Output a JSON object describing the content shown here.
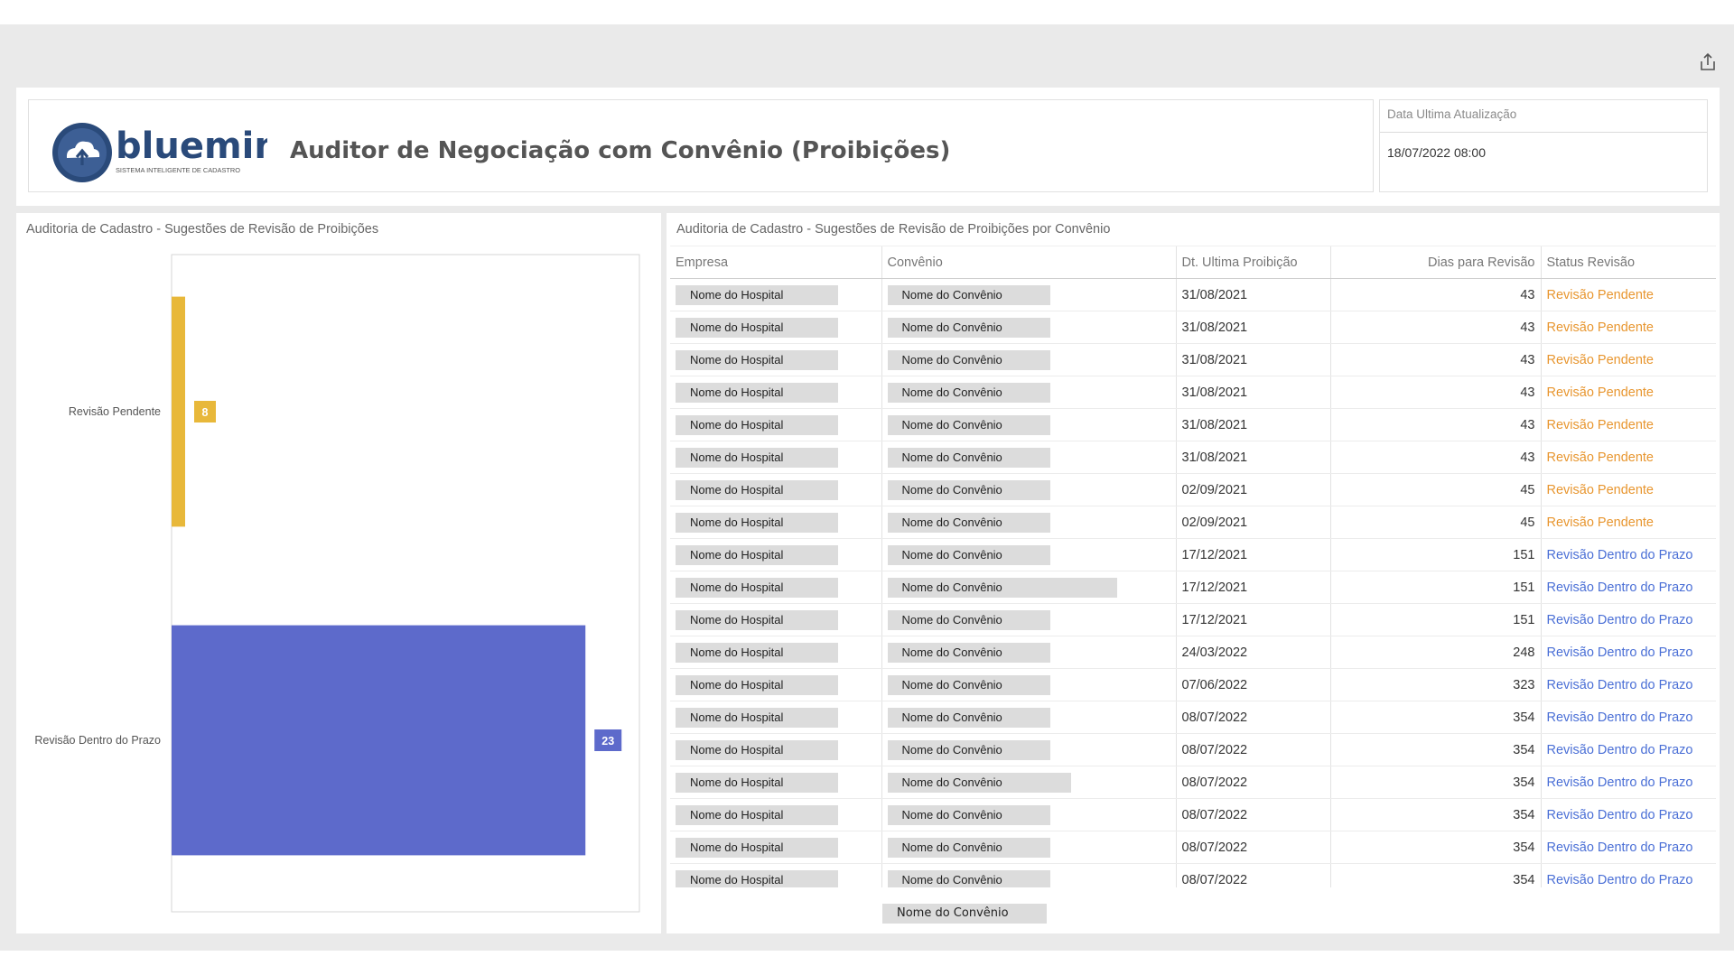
{
  "header": {
    "logo_text": "bluemind",
    "logo_tagline": "SISTEMA INTELIGENTE DE CADASTRO",
    "title": "Auditor de Negociação com Convênio (Proibições)",
    "update_label": "Data Ultima Atualização",
    "update_value": "18/07/2022 08:00"
  },
  "chart_panel": {
    "title": "Auditoria de Cadastro - Sugestões de Revisão de Proibições"
  },
  "chart_data": {
    "type": "bar",
    "orientation": "horizontal",
    "categories": [
      "Revisão Pendente",
      "Revisão Dentro do Prazo"
    ],
    "values": [
      8,
      23
    ],
    "colors": [
      "#e8b83a",
      "#5d6acb"
    ],
    "xlim": [
      0,
      26
    ],
    "grid": false
  },
  "table_panel": {
    "title": "Auditoria de Cadastro - Sugestões de Revisão de Proibições por Convênio",
    "columns": [
      "Empresa",
      "Convênio",
      "Dt. Ultima Proibição",
      "Dias para Revisão",
      "Status Revisão"
    ],
    "rows": [
      {
        "empresa": "Nome do Hospital",
        "convenio": "Nome do Convênio",
        "data": "31/08/2021",
        "dias": "43",
        "status": "Revisão Pendente",
        "kind": "pending"
      },
      {
        "empresa": "Nome do Hospital",
        "convenio": "Nome do Convênio",
        "data": "31/08/2021",
        "dias": "43",
        "status": "Revisão Pendente",
        "kind": "pending"
      },
      {
        "empresa": "Nome do Hospital",
        "convenio": "Nome do Convênio",
        "data": "31/08/2021",
        "dias": "43",
        "status": "Revisão Pendente",
        "kind": "pending"
      },
      {
        "empresa": "Nome do Hospital",
        "convenio": "Nome do Convênio",
        "data": "31/08/2021",
        "dias": "43",
        "status": "Revisão Pendente",
        "kind": "pending"
      },
      {
        "empresa": "Nome do Hospital",
        "convenio": "Nome do Convênio",
        "data": "31/08/2021",
        "dias": "43",
        "status": "Revisão Pendente",
        "kind": "pending"
      },
      {
        "empresa": "Nome do Hospital",
        "convenio": "Nome do Convênio",
        "data": "31/08/2021",
        "dias": "43",
        "status": "Revisão Pendente",
        "kind": "pending"
      },
      {
        "empresa": "Nome do Hospital",
        "convenio": "Nome do Convênio",
        "data": "02/09/2021",
        "dias": "45",
        "status": "Revisão Pendente",
        "kind": "pending"
      },
      {
        "empresa": "Nome do Hospital",
        "convenio": "Nome do Convênio",
        "data": "02/09/2021",
        "dias": "45",
        "status": "Revisão Pendente",
        "kind": "pending"
      },
      {
        "empresa": "Nome do Hospital",
        "convenio": "Nome do Convênio",
        "data": "17/12/2021",
        "dias": "151",
        "status": "Revisão Dentro do Prazo",
        "kind": "ok"
      },
      {
        "empresa": "Nome do Hospital",
        "convenio": "Nome do Convênio",
        "data": "17/12/2021",
        "dias": "151",
        "status": "Revisão Dentro do Prazo",
        "kind": "ok"
      },
      {
        "empresa": "Nome do Hospital",
        "convenio": "Nome do Convênio",
        "data": "17/12/2021",
        "dias": "151",
        "status": "Revisão Dentro do Prazo",
        "kind": "ok"
      },
      {
        "empresa": "Nome do Hospital",
        "convenio": "Nome do Convênio",
        "data": "24/03/2022",
        "dias": "248",
        "status": "Revisão Dentro do Prazo",
        "kind": "ok"
      },
      {
        "empresa": "Nome do Hospital",
        "convenio": "Nome do Convênio",
        "data": "07/06/2022",
        "dias": "323",
        "status": "Revisão Dentro do Prazo",
        "kind": "ok"
      },
      {
        "empresa": "Nome do Hospital",
        "convenio": "Nome do Convênio",
        "data": "08/07/2022",
        "dias": "354",
        "status": "Revisão Dentro do Prazo",
        "kind": "ok"
      },
      {
        "empresa": "Nome do Hospital",
        "convenio": "Nome do Convênio",
        "data": "08/07/2022",
        "dias": "354",
        "status": "Revisão Dentro do Prazo",
        "kind": "ok"
      },
      {
        "empresa": "Nome do Hospital",
        "convenio": "Nome do Convênio",
        "data": "08/07/2022",
        "dias": "354",
        "status": "Revisão Dentro do Prazo",
        "kind": "ok"
      },
      {
        "empresa": "Nome do Hospital",
        "convenio": "Nome do Convênio",
        "data": "08/07/2022",
        "dias": "354",
        "status": "Revisão Dentro do Prazo",
        "kind": "ok"
      },
      {
        "empresa": "Nome do Hospital",
        "convenio": "Nome do Convênio",
        "data": "08/07/2022",
        "dias": "354",
        "status": "Revisão Dentro do Prazo",
        "kind": "ok"
      },
      {
        "empresa": "Nome do Hospital",
        "convenio": "Nome do Convênio",
        "data": "08/07/2022",
        "dias": "354",
        "status": "Revisão Dentro do Prazo",
        "kind": "ok"
      }
    ],
    "overflow_convenio": "Nome do Convênio"
  },
  "colors": {
    "pending": "#e8962f",
    "ok": "#4a6fd6",
    "logo_blue": "#2a4a7a"
  },
  "icons": {
    "share": "share-icon"
  }
}
